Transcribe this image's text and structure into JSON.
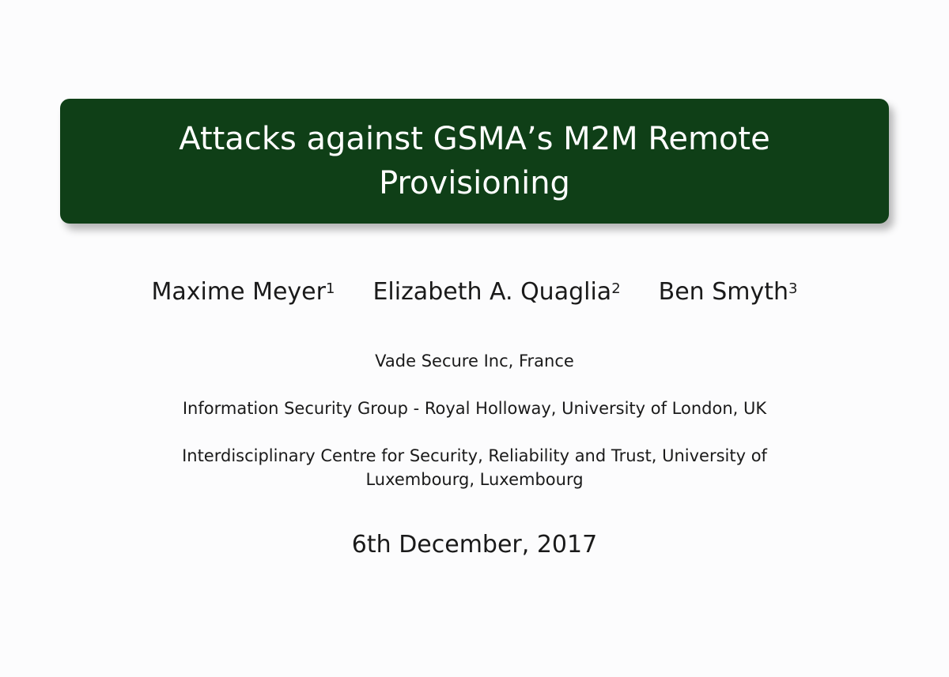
{
  "title": "Attacks against GSMA’s M2M Remote Provisioning",
  "authors": [
    {
      "name": "Maxime Meyer",
      "affiliation_mark": "1"
    },
    {
      "name": "Elizabeth A. Quaglia",
      "affiliation_mark": "2"
    },
    {
      "name": "Ben Smyth",
      "affiliation_mark": "3"
    }
  ],
  "affiliations": [
    "Vade Secure Inc, France",
    "Information Security Group - Royal Holloway, University of London, UK",
    "Interdisciplinary Centre for Security, Reliability and Trust, University of Luxembourg, Luxembourg"
  ],
  "date": "6th December, 2017",
  "colors": {
    "title_background": "#0f3f17",
    "title_text": "#ffffff",
    "background": "#fcfcfd",
    "body_text": "#1a1a1a"
  }
}
